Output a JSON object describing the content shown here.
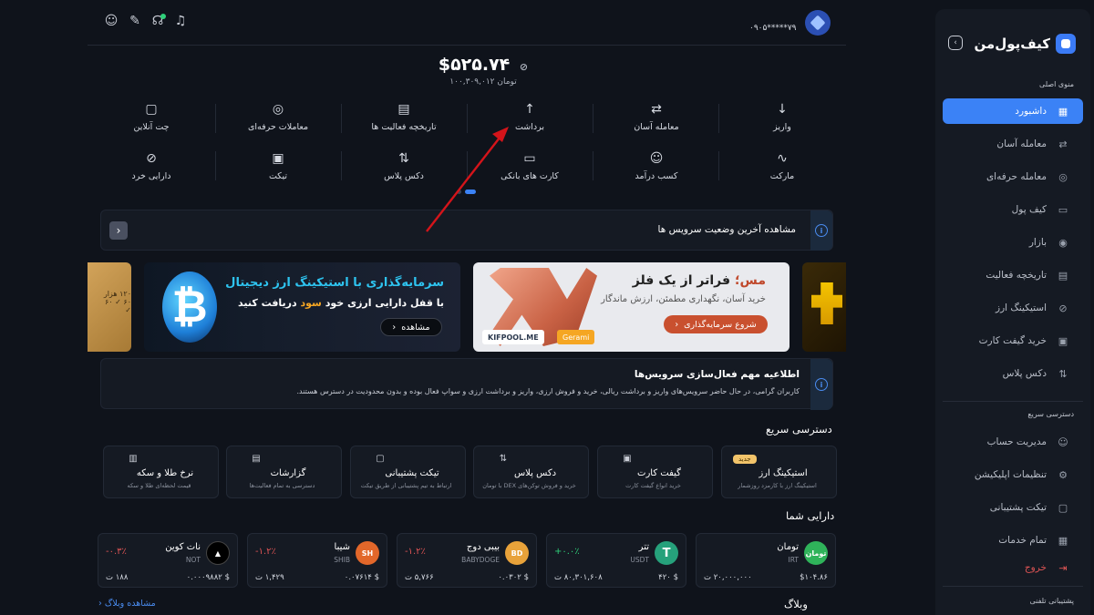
{
  "sidebar": {
    "brand": "کیف‌پول‌من",
    "sections": {
      "main": "منوی اصلی",
      "quick": "دسترسی سریع",
      "support": "پشتیبانی تلفنی"
    },
    "items": [
      {
        "label": "داشبورد",
        "icon": "dashboard-icon"
      },
      {
        "label": "معامله آسان",
        "icon": "swap-icon"
      },
      {
        "label": "معامله حرفه‌ای",
        "icon": "pro-trade-icon"
      },
      {
        "label": "کیف پول",
        "icon": "wallet-icon"
      },
      {
        "label": "بازار",
        "icon": "market-icon"
      },
      {
        "label": "تاریخچه فعالیت",
        "icon": "history-icon"
      },
      {
        "label": "استیکینگ ارز",
        "icon": "staking-icon"
      },
      {
        "label": "خرید گیفت کارت",
        "icon": "giftcard-icon"
      },
      {
        "label": "دکس پلاس",
        "icon": "dex-icon"
      }
    ],
    "quick_items": [
      {
        "label": "مدیریت حساب",
        "icon": "user-icon"
      },
      {
        "label": "تنظیمات اپلیکیشن",
        "icon": "settings-icon"
      },
      {
        "label": "تیکت پشتیبانی",
        "icon": "ticket-icon"
      },
      {
        "label": "تمام خدمات",
        "icon": "grid-icon"
      },
      {
        "label": "خروج",
        "icon": "logout-icon"
      }
    ]
  },
  "header": {
    "phone": "۰۹۰۵*****۷۹",
    "balance_usd": "$۵۲۵.۷۴",
    "balance_toman": "۱۰۰,۳۰۹,۰۱۲ تومان"
  },
  "actions": [
    {
      "label": "واریز",
      "icon": "arrow-down-icon"
    },
    {
      "label": "معامله آسان",
      "icon": "swap-icon"
    },
    {
      "label": "برداشت",
      "icon": "arrow-up-icon"
    },
    {
      "label": "تاریخچه فعالیت ها",
      "icon": "history-icon"
    },
    {
      "label": "معاملات حرفه‌ای",
      "icon": "pro-trade-icon"
    },
    {
      "label": "چت آنلاین",
      "icon": "chat-icon"
    },
    {
      "label": "مارکت",
      "icon": "chart-icon"
    },
    {
      "label": "کسب درآمد",
      "icon": "users-icon"
    },
    {
      "label": "کارت های بانکی",
      "icon": "card-icon"
    },
    {
      "label": "دکس پلاس",
      "icon": "dex-icon"
    },
    {
      "label": "تیکت",
      "icon": "ticket-icon"
    },
    {
      "label": "دارایی خرد",
      "icon": "dust-icon"
    }
  ],
  "service_status": {
    "text": "مشاهده آخرین وضعیت سرویس ها"
  },
  "banners": {
    "crypto": {
      "title": "سرمایه‌گذاری با استیکینگ ارز دیجیتال",
      "line_a": "با قفل دارایی ارزی خود",
      "line_highlight": "سود",
      "line_b": "دریافت کنید",
      "button": "مشاهده"
    },
    "metal": {
      "title_a": "مس؛",
      "title_b": "فراتر از یک فلز",
      "subtitle": "خرید آسان، نگهداری مطمئن، ارزش ماندگار",
      "button": "شروع سرمایه‌گذاری",
      "tag1": "KIFPOOL.ME",
      "tag2": "Gerami"
    },
    "left_peek": "۱۲۰ هزار ۶۰ ✓ ۶۰ ✓"
  },
  "notice": {
    "title": "اطلاعیه مهم فعال‌سازی سرویس‌ها",
    "body": "کاربران گرامی، در حال حاضر سرویس‌های واریز و برداشت ریالی، خرید و فروش ارزی، واریز و برداشت ارزی و سواپ فعال بوده و بدون محدودیت در دسترس هستند."
  },
  "quick_access": {
    "title": "دسترسی سریع",
    "items": [
      {
        "title": "استیکینگ ارز",
        "sub": "استیکینگ ارز با کارمزد روزشمار",
        "icon": "staking-icon",
        "badge": "جدید"
      },
      {
        "title": "گیفت کارت",
        "sub": "خرید انواع گیفت کارت",
        "icon": "gift-icon"
      },
      {
        "title": "دکس پلاس",
        "sub": "خرید و فروش توکن‌های DEX با تومان",
        "icon": "dex-icon"
      },
      {
        "title": "تیکت پشتیبانی",
        "sub": "ارتباط به تیم پشتیبانی از طریق تیکت",
        "icon": "ticket-icon"
      },
      {
        "title": "گزارشات",
        "sub": "دسترسی به تمام فعالیت‌ها",
        "icon": "report-icon"
      },
      {
        "title": "نرخ طلا و سکه",
        "sub": "قیمت لحظه‌ای طلا و سکه",
        "icon": "gold-icon"
      }
    ]
  },
  "assets": {
    "title": "دارایی شما",
    "items": [
      {
        "name": "تومان",
        "symbol": "IRT",
        "change": "",
        "price": "۲۰,۰۰۰,۰۰۰ ت",
        "balance": "$۱۰۴.۸۶",
        "color": "#2fb35a",
        "coin_text": "تومان"
      },
      {
        "name": "تتر",
        "symbol": "USDT",
        "change": "+۰.۰٪",
        "price": "۸۰,۳۰۱,۶۰۸ ت",
        "balance": "$ ۴۲۰",
        "color": "#26a17b",
        "coin_text": "T"
      },
      {
        "name": "بیبی دوج",
        "symbol": "BABYDOGE",
        "change": "-۱.۲٪",
        "price": "۵,۷۶۶ ت",
        "balance": "$ ۰.۰۳۰۲",
        "color": "#e8a23a",
        "coin_text": "BD"
      },
      {
        "name": "شیبا",
        "symbol": "SHIB",
        "change": "-۱.۲٪",
        "price": "۱,۴۲۹ ت",
        "balance": "$ ۰.۰۷۶۱۴",
        "color": "#e2672a",
        "coin_text": "SH"
      },
      {
        "name": "نات کوین",
        "symbol": "NOT",
        "change": "-۰.۳٪",
        "price": "۱۸۸ ت",
        "balance": "$ ۰.۰۰۰۹۸۸۲",
        "color": "#000000",
        "coin_text": "▲"
      }
    ]
  },
  "blog": {
    "title": "وبلاگ",
    "link": "مشاهده وبلاگ"
  }
}
